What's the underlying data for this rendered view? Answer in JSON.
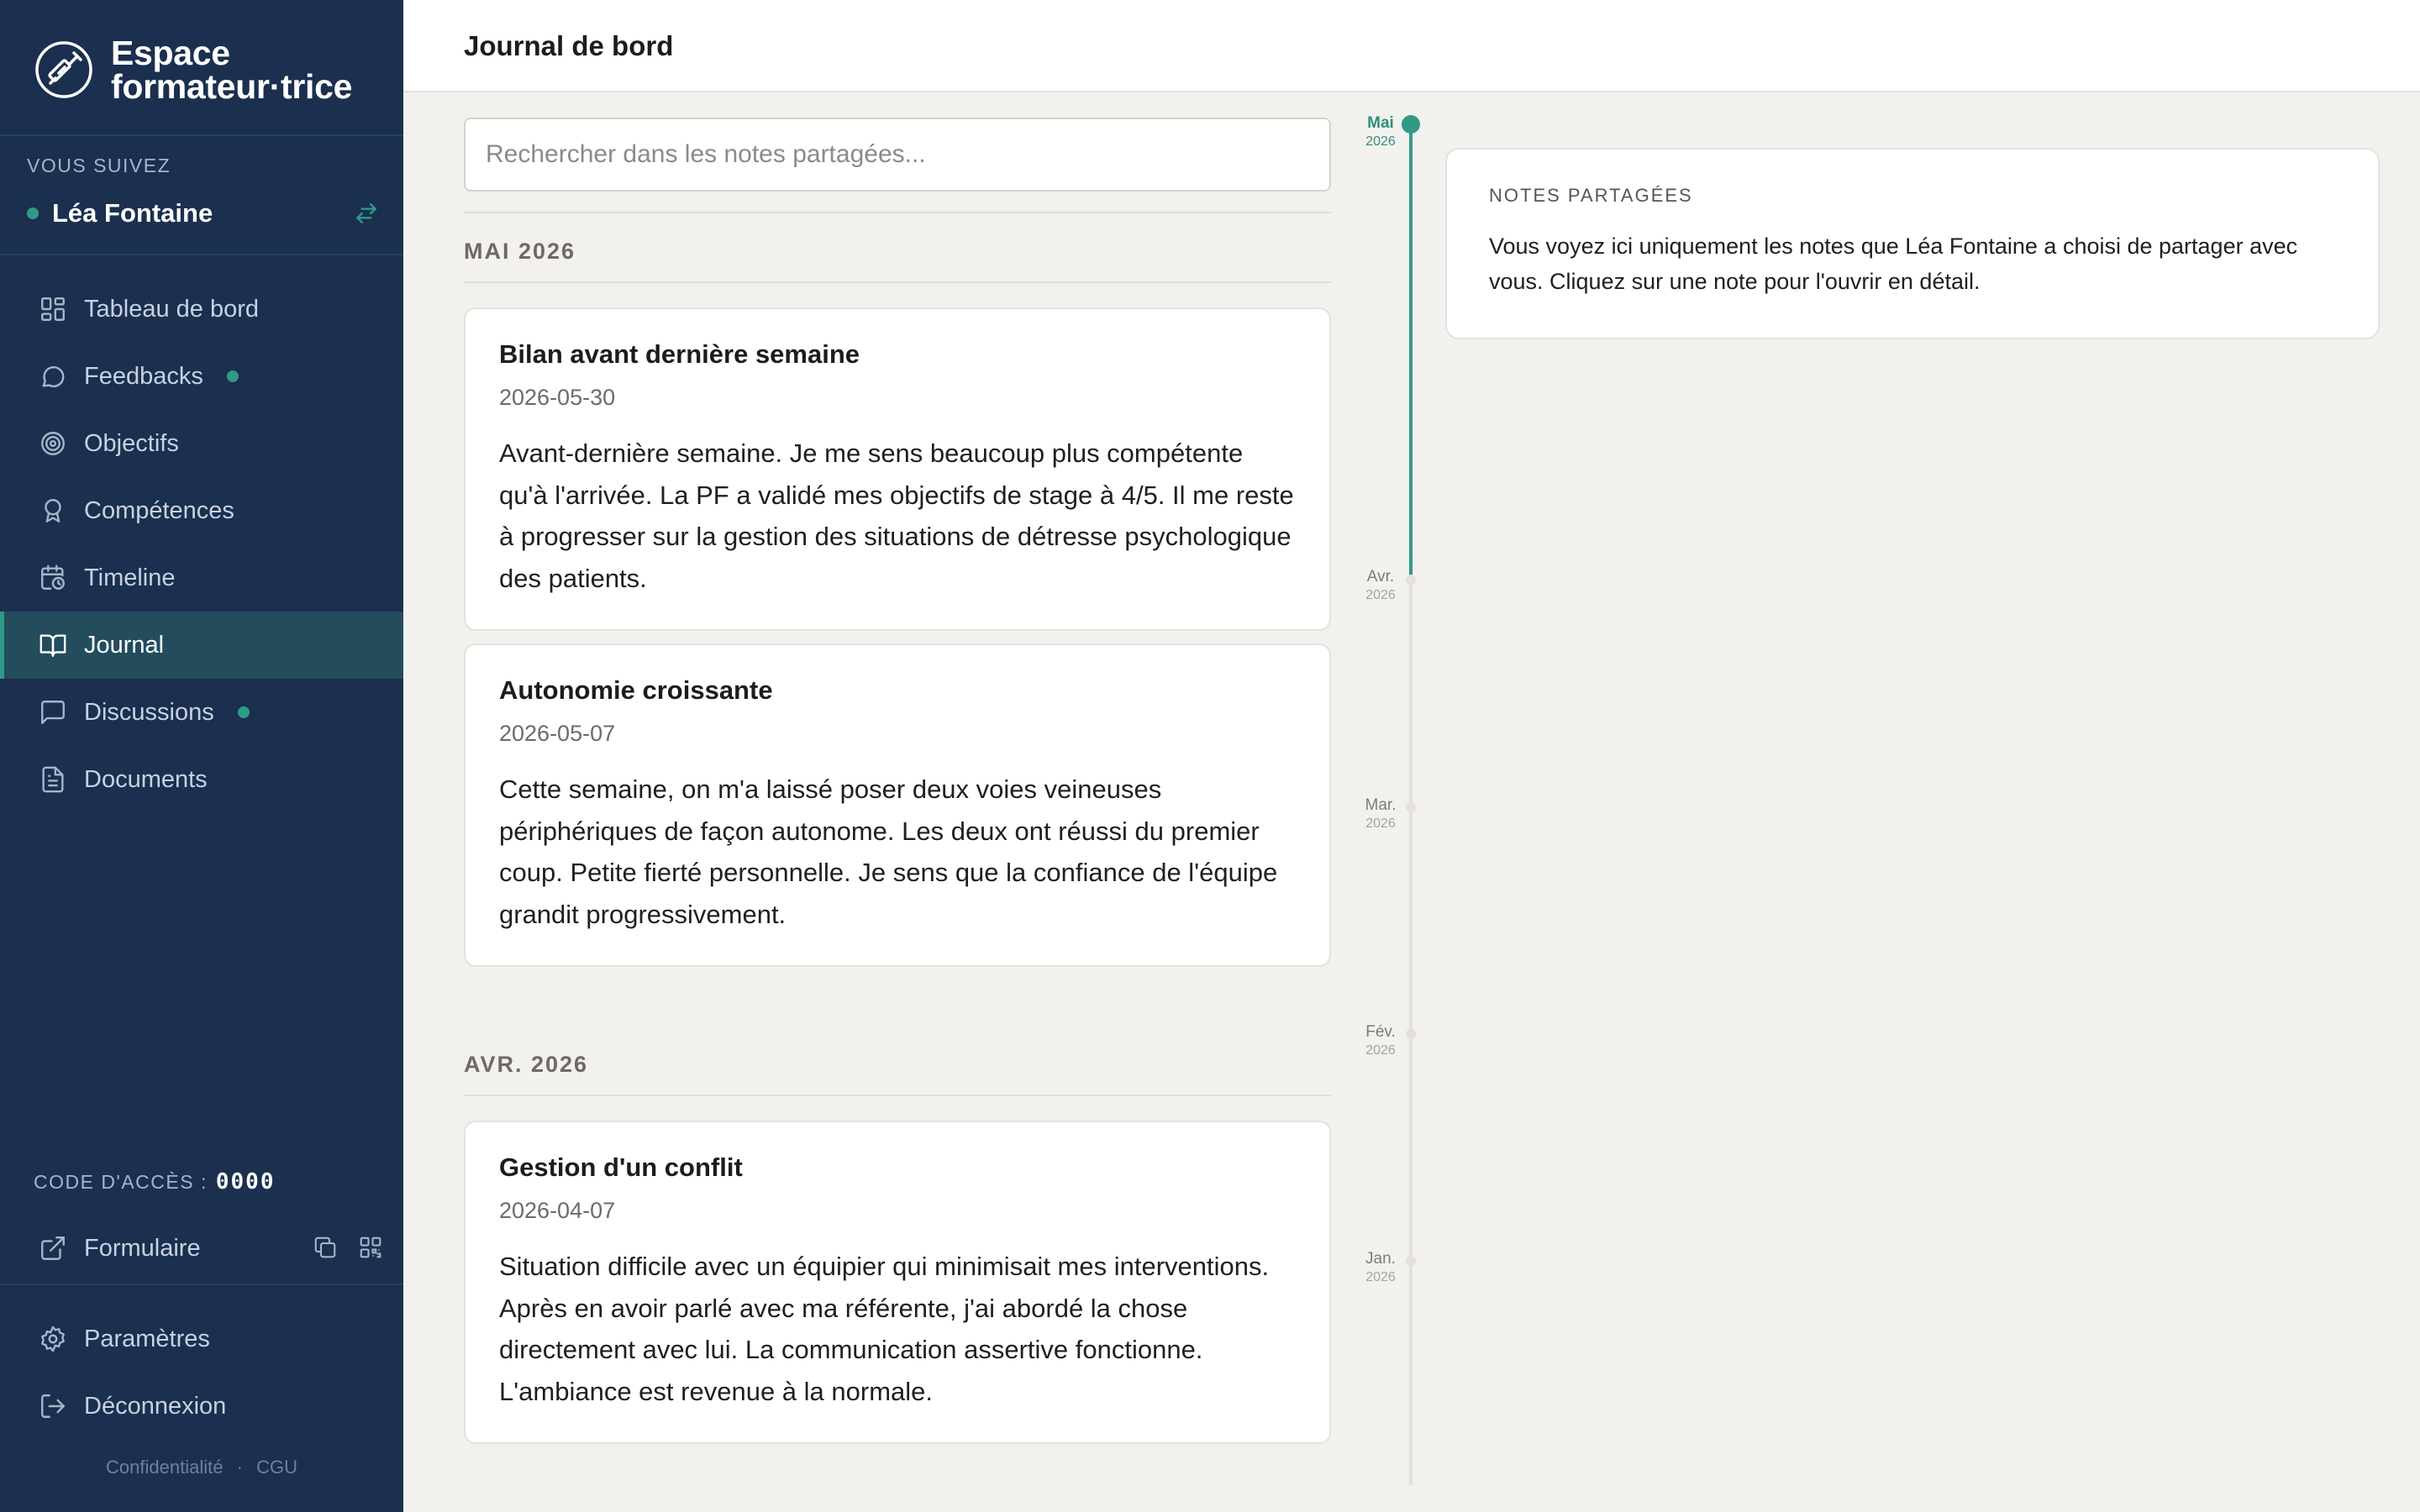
{
  "app": {
    "brand_line1": "Espace",
    "brand_line2": "formateur·trice"
  },
  "sidebar": {
    "follow_label": "VOUS SUIVEZ",
    "followed_user": "Léa Fontaine",
    "items": [
      {
        "label": "Tableau de bord",
        "icon": "dashboard-icon",
        "badge": false,
        "active": false
      },
      {
        "label": "Feedbacks",
        "icon": "chat-bubble-icon",
        "badge": true,
        "active": false
      },
      {
        "label": "Objectifs",
        "icon": "target-icon",
        "badge": false,
        "active": false
      },
      {
        "label": "Compétences",
        "icon": "award-icon",
        "badge": false,
        "active": false
      },
      {
        "label": "Timeline",
        "icon": "calendar-clock-icon",
        "badge": false,
        "active": false
      },
      {
        "label": "Journal",
        "icon": "book-open-icon",
        "badge": false,
        "active": true
      },
      {
        "label": "Discussions",
        "icon": "message-square-icon",
        "badge": true,
        "active": false
      },
      {
        "label": "Documents",
        "icon": "document-icon",
        "badge": false,
        "active": false
      }
    ],
    "code_label": "CODE D'ACCÈS :",
    "code_value": "0000",
    "form_label": "Formulaire",
    "settings_label": "Paramètres",
    "logout_label": "Déconnexion",
    "footer_privacy": "Confidentialité",
    "footer_separator": "·",
    "footer_terms": "CGU"
  },
  "header": {
    "title": "Journal de bord"
  },
  "search": {
    "placeholder": "Rechercher dans les notes partagées..."
  },
  "journal": {
    "groups": [
      {
        "month": "MAI 2026",
        "entries": [
          {
            "title": "Bilan avant dernière semaine",
            "date": "2026-05-30",
            "body": "Avant-dernière semaine. Je me sens beaucoup plus compétente qu'à l'arrivée. La PF a validé mes objectifs de stage à 4/5. Il me reste à progresser sur la gestion des situations de détresse psychologique des patients."
          },
          {
            "title": "Autonomie croissante",
            "date": "2026-05-07",
            "body": "Cette semaine, on m'a laissé poser deux voies veineuses périphériques de façon autonome. Les deux ont réussi du premier coup. Petite fierté personnelle. Je sens que la confiance de l'équipe grandit progressivement."
          }
        ]
      },
      {
        "month": "AVR. 2026",
        "entries": [
          {
            "title": "Gestion d'un conflit",
            "date": "2026-04-07",
            "body": "Situation difficile avec un équipier qui minimisait mes interventions. Après en avoir parlé avec ma référente, j'ai abordé la chose directement avec lui. La communication assertive fonctionne. L'ambiance est revenue à la normale."
          }
        ]
      }
    ]
  },
  "timeline": {
    "months": [
      {
        "month": "Mai",
        "year": "2026",
        "active": true
      },
      {
        "month": "Avr.",
        "year": "2026",
        "active": false
      },
      {
        "month": "Mar.",
        "year": "2026",
        "active": false
      },
      {
        "month": "Fév.",
        "year": "2026",
        "active": false
      },
      {
        "month": "Jan.",
        "year": "2026",
        "active": false
      }
    ]
  },
  "info_panel": {
    "title": "NOTES PARTAGÉES",
    "text": "Vous voyez ici uniquement les notes que Léa Fontaine a choisi de partager avec vous. Cliquez sur une note pour l'ouvrir en détail."
  },
  "colors": {
    "sidebar_bg": "#1b2f4f",
    "accent": "#2f9a86",
    "page_bg": "#f2f1ed"
  }
}
